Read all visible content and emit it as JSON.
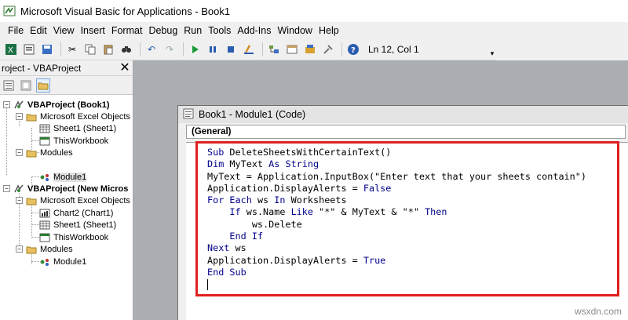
{
  "window": {
    "title": "Microsoft Visual Basic for Applications - Book1"
  },
  "menu": [
    "File",
    "Edit",
    "View",
    "Insert",
    "Format",
    "Debug",
    "Run",
    "Tools",
    "Add-Ins",
    "Window",
    "Help"
  ],
  "toolbar": {
    "cursor_position": "Ln 12, Col 1"
  },
  "project_explorer": {
    "title": "roject - VBAProject",
    "tree": [
      {
        "label": "VBAProject (Book1)",
        "bold": true
      },
      {
        "label": "Microsoft Excel Objects"
      },
      {
        "label": "Sheet1 (Sheet1)"
      },
      {
        "label": "ThisWorkbook"
      },
      {
        "label": "Modules"
      },
      {
        "label": "Module1"
      },
      {
        "label": "VBAProject (New Micros",
        "bold": true
      },
      {
        "label": "Microsoft Excel Objects"
      },
      {
        "label": "Chart2 (Chart1)"
      },
      {
        "label": "Sheet1 (Sheet1)"
      },
      {
        "label": "ThisWorkbook"
      },
      {
        "label": "Modules"
      },
      {
        "label": "Module1"
      }
    ]
  },
  "code_window": {
    "title": "Book1 - Module1 (Code)",
    "object_combo": "(General)",
    "lines": [
      "Sub DeleteSheetsWithCertainText()",
      "Dim MyText As String",
      "MyText = Application.InputBox(\"Enter text that your sheets contain\")",
      "Application.DisplayAlerts = False",
      "For Each ws In Worksheets",
      "    If ws.Name Like \"*\" & MyText & \"*\" Then",
      "        ws.Delete",
      "    End If",
      "Next ws",
      "Application.DisplayAlerts = True",
      "End Sub"
    ]
  },
  "watermark": "wsxdn.com",
  "colors": {
    "highlight_border": "#e02020",
    "keyword": "#00008b",
    "workspace": "#abafb4"
  }
}
